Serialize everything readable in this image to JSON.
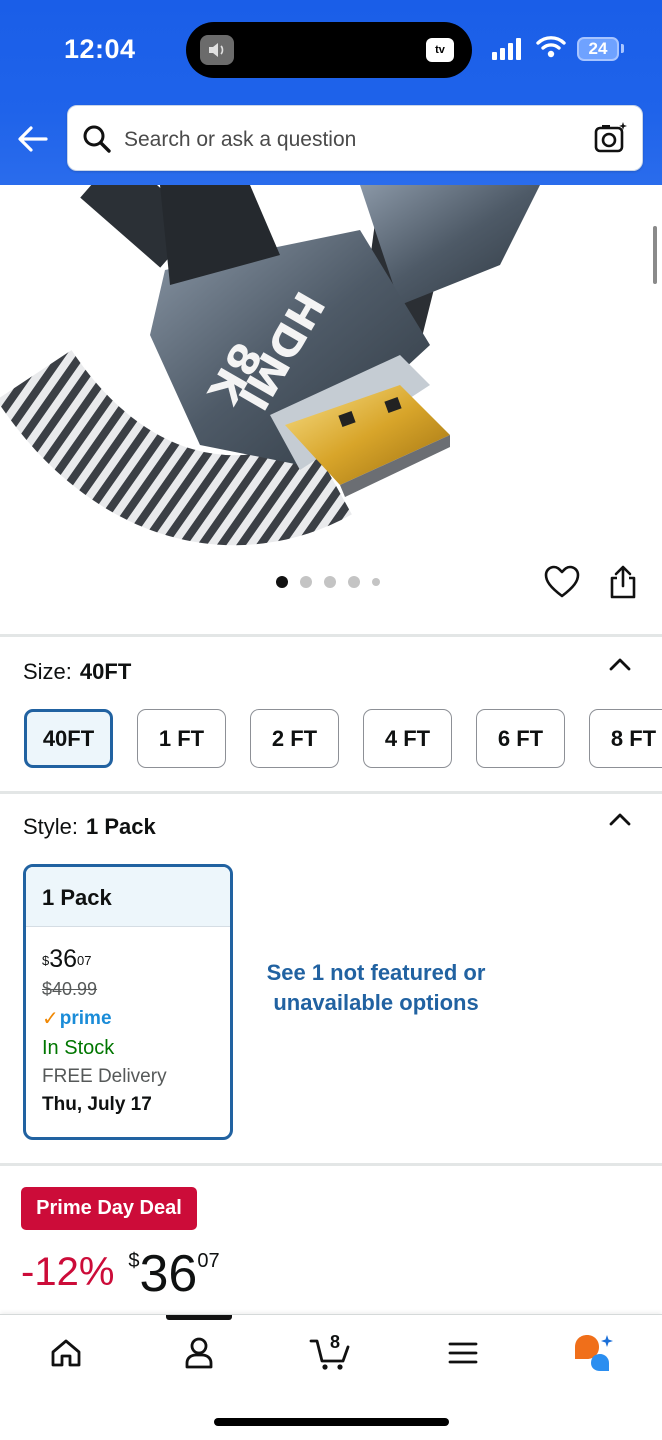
{
  "status_bar": {
    "time": "12:04",
    "island_right_label": "tv",
    "battery": "24"
  },
  "search": {
    "placeholder": "Search or ask a question"
  },
  "gallery": {
    "image_text_brand": "HDMI",
    "image_text_spec": "8K",
    "dots_total": 5,
    "active_dot": 0
  },
  "size": {
    "label": "Size:",
    "selected": "40FT",
    "options": [
      "40FT",
      "1 FT",
      "2 FT",
      "4 FT",
      "6 FT",
      "8 FT"
    ]
  },
  "style": {
    "label": "Style:",
    "selected": "1 Pack",
    "card": {
      "title": "1 Pack",
      "currency": "$",
      "price_whole": "36",
      "price_fraction": "07",
      "was_price": "$40.99",
      "prime_label": "prime",
      "stock": "In Stock",
      "delivery": "FREE Delivery",
      "delivery_date": "Thu, July 17"
    },
    "see_more": "See 1 not featured or unavailable options"
  },
  "deal": {
    "badge": "Prime Day Deal",
    "discount": "-12%",
    "currency": "$",
    "price_whole": "36",
    "price_fraction": "07"
  },
  "bottom_nav": {
    "cart_count": "8",
    "items": [
      "home-icon",
      "account-icon",
      "cart-icon",
      "menu-icon",
      "rufus-icon"
    ]
  },
  "colors": {
    "header_blue": "#1f63ea",
    "link_blue": "#2162a1",
    "deal_red": "#cc0c39",
    "in_stock_green": "#007600",
    "prime_blue": "#1a8cd8"
  }
}
